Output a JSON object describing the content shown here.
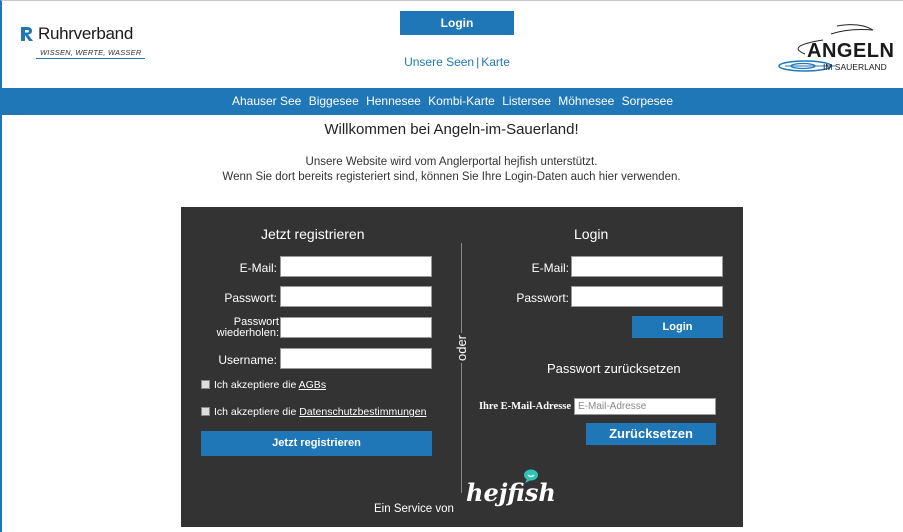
{
  "header": {
    "ruhrverband": {
      "name": "Ruhrverband",
      "tagline": "WISSEN, WERTE, WASSER"
    },
    "login_button": "Login",
    "links": [
      "Unsere Seen",
      "Karte"
    ],
    "angeln_logo": {
      "big": "ANGELN",
      "small": "IM SAUERLAND"
    }
  },
  "nav": {
    "items": [
      "Ahauser See",
      "Biggesee",
      "Hennesee",
      "Kombi-Karte",
      "Listersee",
      "Möhnesee",
      "Sorpesee"
    ]
  },
  "welcome": "Willkommen bei Angeln-im-Sauerland!",
  "intro": {
    "line1": "Unsere Website wird vom Anglerportal hejfish unterstützt.",
    "line2": "Wenn Sie dort bereits registeriert sind, können Sie Ihre Login-Daten auch hier verwenden."
  },
  "register": {
    "title": "Jetzt registrieren",
    "email_label": "E-Mail:",
    "password_label": "Passwort:",
    "repeat_label_1": "Passwort",
    "repeat_label_2": "wiederholen:",
    "username_label": "Username:",
    "agb_text": "Ich akzeptiere die ",
    "agb_link": "AGBs",
    "privacy_text": "Ich akzeptiere die ",
    "privacy_link": "Datenschutzbestimmungen",
    "submit": "Jetzt registrieren"
  },
  "divider_label": "oder",
  "login": {
    "title": "Login",
    "email_label": "E-Mail:",
    "password_label": "Passwort:",
    "submit": "Login"
  },
  "reset": {
    "title": "Passwort zurücksetzen",
    "email_label": "Ihre E-Mail-Adresse",
    "placeholder": "E-Mail-Adresse",
    "submit": "Zurücksetzen"
  },
  "footer": {
    "service": "Ein Service von",
    "brand": "hejfish"
  },
  "colors": {
    "accent": "#1f77b8",
    "panel": "#333333"
  }
}
